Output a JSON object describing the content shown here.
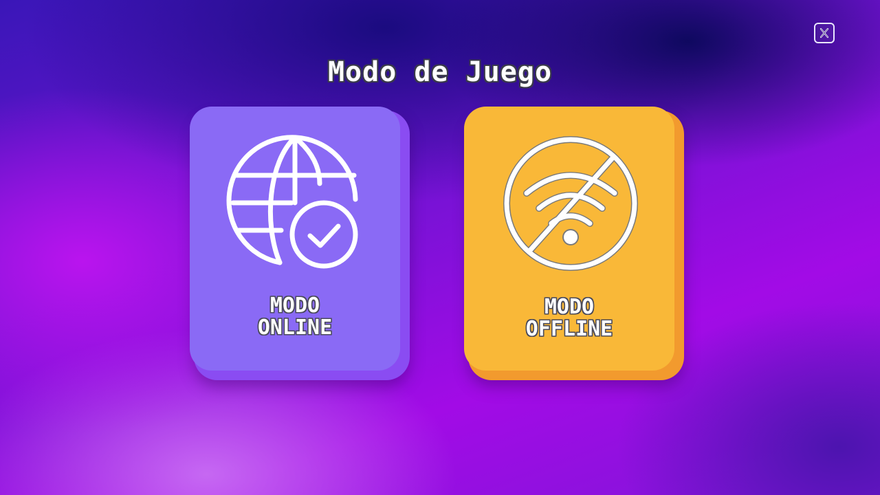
{
  "title": "Modo de Juego",
  "close_button": {
    "icon": "close-icon"
  },
  "modes": [
    {
      "id": "online",
      "label_line1": "MODO",
      "label_line2": "ONLINE",
      "icon": "globe-check-icon",
      "color": "#8a6af5",
      "shadow_color": "#8a4cf2"
    },
    {
      "id": "offline",
      "label_line1": "MODO",
      "label_line2": "OFFLINE",
      "icon": "wifi-off-icon",
      "color": "#f9b838",
      "shadow_color": "#f29a2e"
    }
  ]
}
